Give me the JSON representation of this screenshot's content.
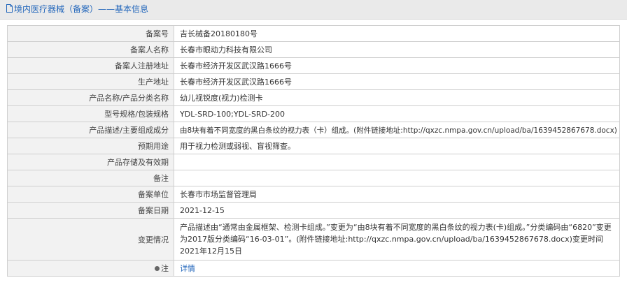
{
  "header": {
    "title": "境内医疗器械（备案）——基本信息"
  },
  "rows": [
    {
      "label": "备案号",
      "value": "吉长械备20180180号"
    },
    {
      "label": "备案人名称",
      "value": "长春市眼动力科技有限公司"
    },
    {
      "label": "备案人注册地址",
      "value": "长春市经济开发区武汉路1666号"
    },
    {
      "label": "生产地址",
      "value": "长春市经济开发区武汉路1666号"
    },
    {
      "label": "产品名称/产品分类名称",
      "value": "幼儿视锐度(视力)检测卡"
    },
    {
      "label": "型号规格/包装规格",
      "value": "YDL-SRD-100;YDL-SRD-200"
    },
    {
      "label": "产品描述/主要组成成分",
      "value": "由8块有着不同宽度的黑白条纹的视力表（卡）组成。(附件链接地址:http://qxzc.nmpa.gov.cn/upload/ba/1639452867678.docx)"
    },
    {
      "label": "预期用途",
      "value": "用于视力检测或弱视、盲视筛查。"
    },
    {
      "label": "产品存储及有效期",
      "value": ""
    },
    {
      "label": "备注",
      "value": ""
    },
    {
      "label": "备案单位",
      "value": "长春市市场监督管理局"
    },
    {
      "label": "备案日期",
      "value": "2021-12-15"
    },
    {
      "label": "变更情况",
      "value": "产品描述由“通常由金属框架、检测卡组成。”变更为“由8块有着不同宽度的黑白条纹的视力表(卡)组成。”分类编码由“6820”变更为2017版分类编码“16-03-01”。(附件链接地址:http://qxzc.nmpa.gov.cn/upload/ba/1639452867678.docx)变更时间2021年12月15日"
    }
  ],
  "note": {
    "label": "注",
    "link_text": "详情"
  },
  "colors": {
    "accent": "#2266bb",
    "header_bg": "#eaeaea",
    "label_bg": "#f2f2f2",
    "border": "#cfcfcf"
  }
}
